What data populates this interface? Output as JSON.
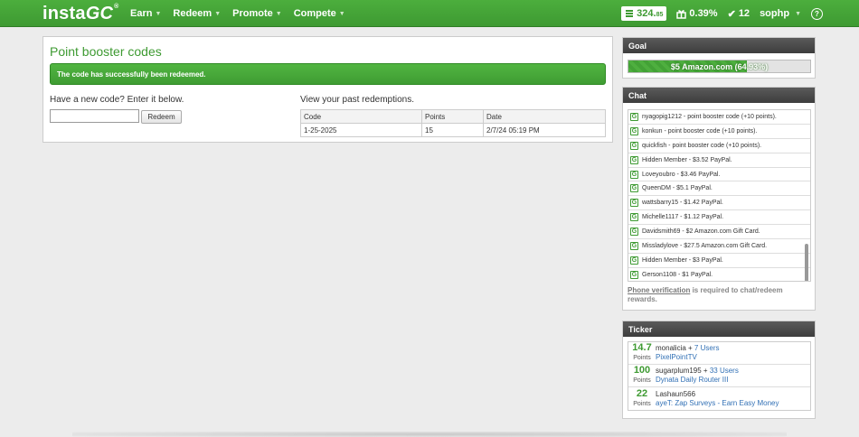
{
  "brand": {
    "logo_prefix": "insta",
    "logo_suffix": "GC",
    "reg": "®",
    "accent": "#3e9a32"
  },
  "nav": [
    {
      "label": "Earn"
    },
    {
      "label": "Redeem"
    },
    {
      "label": "Promote"
    },
    {
      "label": "Compete"
    }
  ],
  "user_bar": {
    "points_main": "324.",
    "points_dec": "85",
    "rate": "0.39%",
    "completed": "12",
    "username": "sophp"
  },
  "main": {
    "title": "Point booster codes",
    "alert": "The code has successfully been redeemed.",
    "enter_label": "Have a new code? Enter it below.",
    "input_value": "",
    "redeem_label": "Redeem",
    "past_label": "View your past redemptions.",
    "table": {
      "headers": [
        "Code",
        "Points",
        "Date"
      ],
      "rows": [
        [
          "1-25-2025",
          "15",
          "2/7/24 05:19 PM"
        ]
      ]
    }
  },
  "goal": {
    "header": "Goal",
    "text": "$5 Amazon.com (64.93%)",
    "progress": 0.6493
  },
  "chat": {
    "header": "Chat",
    "items": [
      "nyagopig1212 - point booster code (+10 points).",
      "konkun - point booster code (+10 points).",
      "quickfish - point booster code (+10 points).",
      "Hidden Member - $3.52 PayPal.",
      "Loveyoubro - $3.46 PayPal.",
      "QueenDM - $5.1 PayPal.",
      "wattsbarry15 - $1.42 PayPal.",
      "Michelle1117 - $1.12 PayPal.",
      "Davidsmith69 - $2 Amazon.com Gift Card.",
      "Missladylove - $27.5 Amazon.com Gift Card.",
      "Hidden Member - $3 PayPal.",
      "Gerson1108 - $1 PayPal."
    ],
    "note_link": "Phone verification",
    "note_rest": " is required to chat/redeem rewards."
  },
  "ticker": {
    "header": "Ticker",
    "points_label": "Points",
    "rows": [
      {
        "points": "14.7",
        "user": "monalicia",
        "plus": " + ",
        "users": "7 Users",
        "offer": "PixelPointTV"
      },
      {
        "points": "100",
        "user": "sugarplum195",
        "plus": " + ",
        "users": "33 Users",
        "offer": "Dynata Daily Router III"
      },
      {
        "points": "22",
        "user": "Lashaun566",
        "plus": "",
        "users": "",
        "offer": "ayeT: Zap Surveys - Earn Easy Money"
      }
    ]
  }
}
